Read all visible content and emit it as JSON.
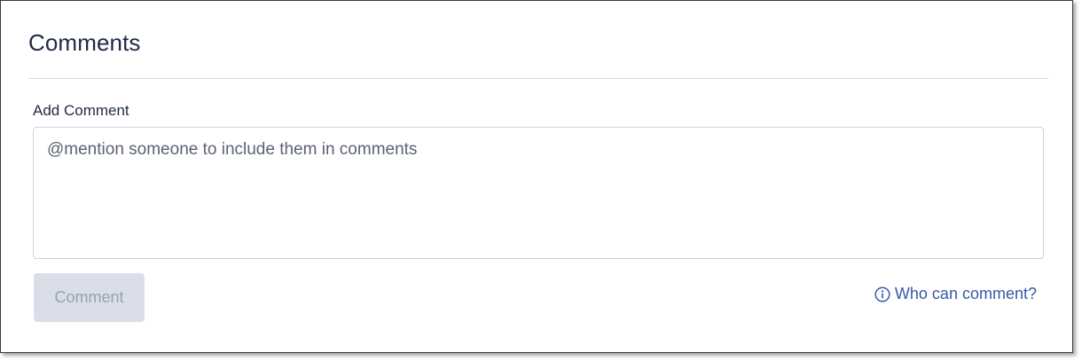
{
  "comments": {
    "title": "Comments",
    "add_label": "Add Comment",
    "textarea_placeholder": "@mention someone to include them in comments",
    "submit_label": "Comment",
    "who_can_comment_label": "Who can comment?",
    "icons": {
      "info": "info-icon"
    },
    "colors": {
      "title": "#1f2a44",
      "link": "#3a57a8",
      "button_disabled_bg": "#d9dee8",
      "button_disabled_text": "#9aa2b1"
    }
  }
}
